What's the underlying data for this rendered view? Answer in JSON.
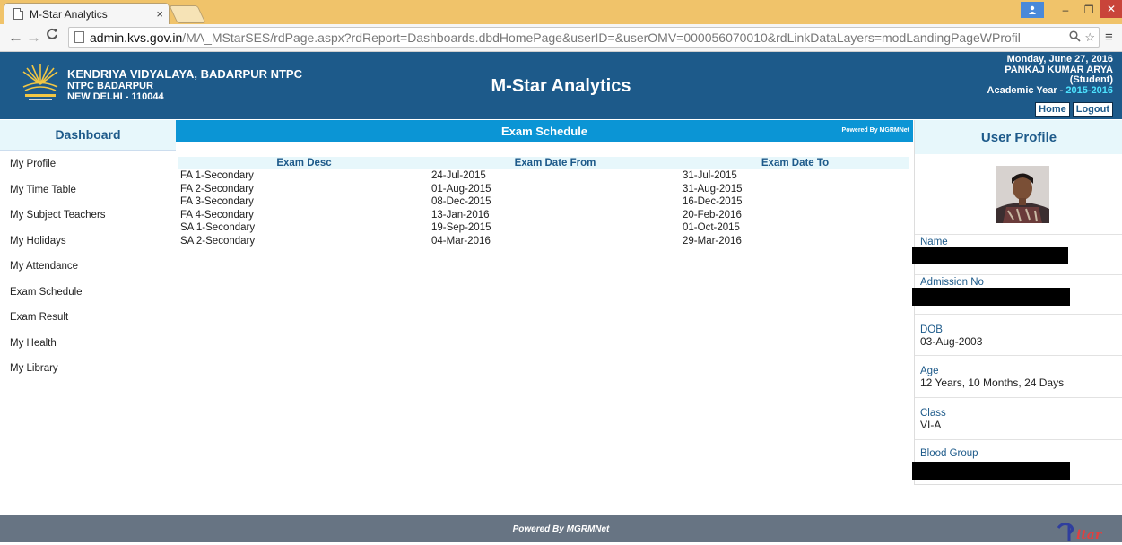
{
  "browser": {
    "tab_title": "M-Star Analytics",
    "tab_close": "×",
    "url_host": "admin.kvs.gov.in",
    "url_rest": "/MA_MStarSES/rdPage.aspx?rdReport=Dashboards.dbdHomePage&userID=&userOMV=000056070010&rdLinkDataLayers=modLandingPageWProfil",
    "back_icon": "←",
    "forward_icon": "→",
    "reload_icon": "C",
    "zoom_icon": "🔍",
    "star_icon": "☆",
    "menu_icon": "≡",
    "win_min": "–",
    "win_max": "❐",
    "win_close": "✕",
    "user_icon": "👤"
  },
  "header": {
    "school_name": "KENDRIYA VIDYALAYA, BADARPUR NTPC",
    "school_line2": "NTPC BADARPUR",
    "school_line3": "NEW DELHI - 110044",
    "app_title": "M-Star Analytics",
    "date": "Monday, June 27, 2016",
    "user_name": "PANKAJ KUMAR ARYA",
    "user_role": "(Student)",
    "academic_year_label": "Academic Year - ",
    "academic_year": "2015-2016",
    "home_label": "Home",
    "logout_label": "Logout",
    "brand_color": "#1d5a8a"
  },
  "sidebar": {
    "title": "Dashboard",
    "items": [
      {
        "label": "My Profile"
      },
      {
        "label": "My Time Table"
      },
      {
        "label": "My Subject Teachers"
      },
      {
        "label": "My Holidays"
      },
      {
        "label": "My Attendance"
      },
      {
        "label": "Exam Schedule"
      },
      {
        "label": "Exam Result"
      },
      {
        "label": "My Health"
      },
      {
        "label": "My Library"
      }
    ]
  },
  "exam_schedule": {
    "title": "Exam Schedule",
    "powered_by": "Powered By MGRMNet",
    "headers": [
      "Exam Desc",
      "Exam Date From",
      "Exam Date To"
    ],
    "rows": [
      [
        "FA 1-Secondary",
        "24-Jul-2015",
        "31-Jul-2015"
      ],
      [
        "FA 2-Secondary",
        "01-Aug-2015",
        "31-Aug-2015"
      ],
      [
        "FA 3-Secondary",
        "08-Dec-2015",
        "16-Dec-2015"
      ],
      [
        "FA 4-Secondary",
        "13-Jan-2016",
        "20-Feb-2016"
      ],
      [
        "SA 1-Secondary",
        "19-Sep-2015",
        "01-Oct-2015"
      ],
      [
        "SA 2-Secondary",
        "04-Mar-2016",
        "29-Mar-2016"
      ]
    ]
  },
  "profile": {
    "title": "User Profile",
    "name_label": "Name",
    "admission_label": "Admission No",
    "dob_label": "DOB",
    "dob": "03-Aug-2003",
    "age_label": "Age",
    "age": "12 Years, 10 Months, 24 Days",
    "class_label": "Class",
    "class": "VI-A",
    "blood_label": "Blood Group"
  },
  "footer": {
    "powered_by": "Powered By MGRMNet"
  }
}
